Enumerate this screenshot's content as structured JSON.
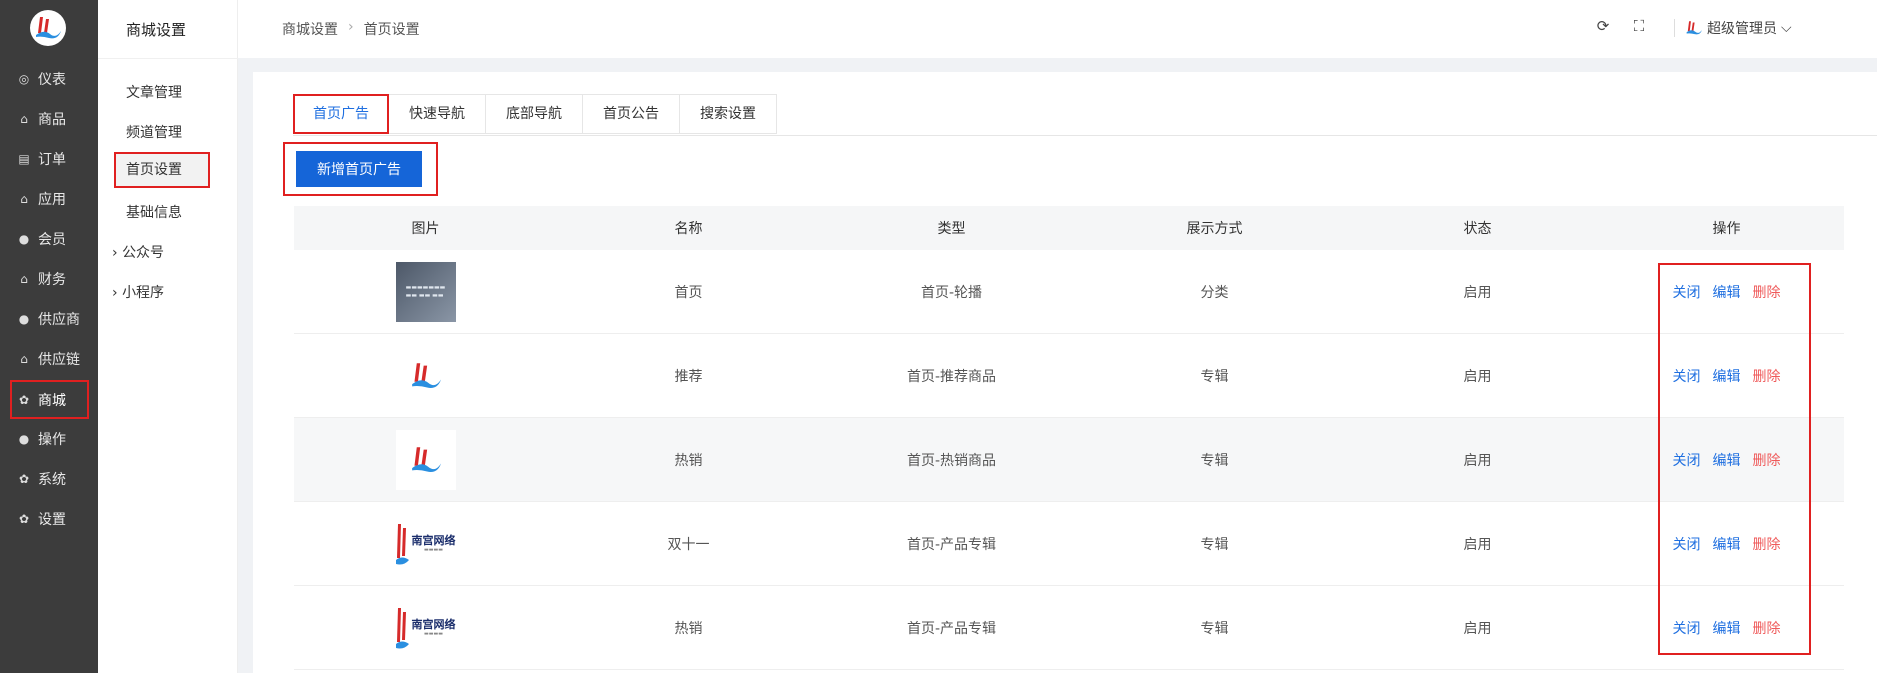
{
  "colors": {
    "sidebar_bg": "#3c3c3c",
    "primary": "#1565d8",
    "link": "#1f6fe0",
    "danger": "#ef5a5a",
    "highlight": "#e02020"
  },
  "sidebar": {
    "items": [
      {
        "label": "仪表",
        "icon": "dashboard-icon"
      },
      {
        "label": "商品",
        "icon": "bag-icon"
      },
      {
        "label": "订单",
        "icon": "clipboard-icon"
      },
      {
        "label": "应用",
        "icon": "bag-icon"
      },
      {
        "label": "会员",
        "icon": "user-icon"
      },
      {
        "label": "财务",
        "icon": "bag-icon"
      },
      {
        "label": "供应商",
        "icon": "user-icon"
      },
      {
        "label": "供应链",
        "icon": "bag-icon"
      },
      {
        "label": "商城",
        "icon": "gear-icon"
      },
      {
        "label": "操作",
        "icon": "user-icon"
      },
      {
        "label": "系统",
        "icon": "gear-icon"
      },
      {
        "label": "设置",
        "icon": "gear-icon"
      }
    ]
  },
  "subnav": {
    "title": "商城设置",
    "items": [
      "文章管理",
      "频道管理",
      "首页设置",
      "基础信息"
    ],
    "groups": [
      "公众号",
      "小程序"
    ]
  },
  "header": {
    "breadcrumb": [
      "商城设置",
      "首页设置"
    ],
    "user": "超级管理员"
  },
  "tabs": [
    "首页广告",
    "快速导航",
    "底部导航",
    "首页公告",
    "搜索设置"
  ],
  "add_button": "新增首页广告",
  "table": {
    "columns": [
      "图片",
      "名称",
      "类型",
      "展示方式",
      "状态",
      "操作"
    ],
    "actions": {
      "close": "关闭",
      "edit": "编辑",
      "delete": "删除"
    },
    "rows": [
      {
        "name": "首页",
        "type": "首页-轮播",
        "display": "分类",
        "status": "启用"
      },
      {
        "name": "推荐",
        "type": "首页-推荐商品",
        "display": "专辑",
        "status": "启用"
      },
      {
        "name": "热销",
        "type": "首页-热销商品",
        "display": "专辑",
        "status": "启用"
      },
      {
        "name": "双十一",
        "type": "首页-产品专辑",
        "display": "专辑",
        "status": "启用"
      },
      {
        "name": "热销",
        "type": "首页-产品专辑",
        "display": "专辑",
        "status": "启用"
      }
    ]
  },
  "brand_text": "南宫网络"
}
